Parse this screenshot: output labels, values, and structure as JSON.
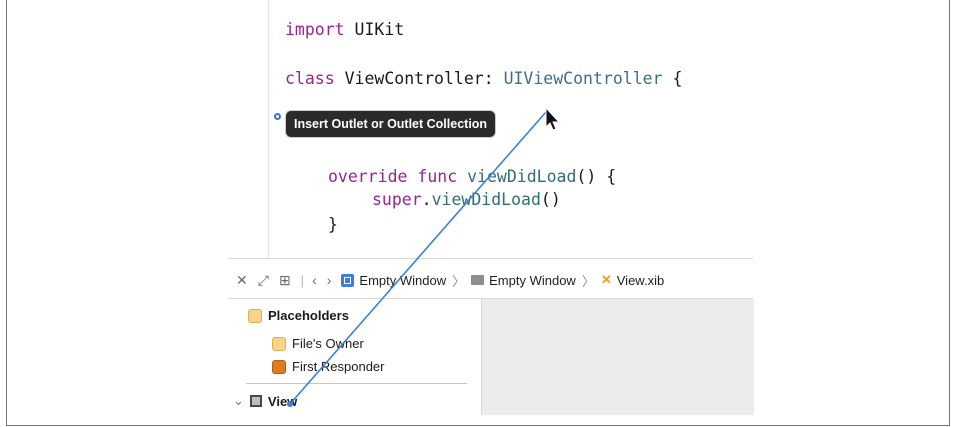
{
  "editor": {
    "line1": {
      "kw": "import",
      "name": "UIKit"
    },
    "line2": {
      "kw": "class",
      "name": "ViewController",
      "colon": ":",
      "super": "UIViewController",
      "brace": "{"
    },
    "tooltip": "Insert Outlet or Outlet Collection",
    "line4": {
      "kw1": "override",
      "kw2": "func",
      "name": "viewDidLoad",
      "rest": "() {"
    },
    "line5": {
      "kw": "super",
      "dot": ".",
      "name": "viewDidLoad",
      "rest": "()"
    },
    "line6": "}"
  },
  "jumpbar": {
    "icons": [
      "close-icon",
      "expand-icon",
      "grid-icon",
      "back-icon",
      "forward-icon"
    ],
    "crumbs": [
      "Empty Window",
      "Empty Window",
      "View.xib"
    ]
  },
  "outline": {
    "section": "Placeholders",
    "items": [
      "File's Owner",
      "First Responder"
    ],
    "view": "View"
  },
  "colors": {
    "keyword": "#9b2393",
    "type": "#3e6d8d",
    "connection_line": "#3a80d9"
  }
}
